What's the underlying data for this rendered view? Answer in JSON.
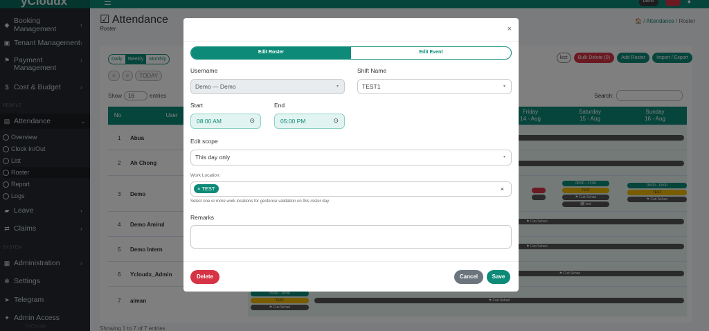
{
  "app": {
    "brand": "yCloudx",
    "user_badge": "Demo"
  },
  "sidebar": {
    "items": [
      {
        "label": "Booking Management"
      },
      {
        "label": "Tenant Management"
      },
      {
        "label": "Payment Management"
      },
      {
        "label": "Cost & Budget"
      }
    ],
    "section_people": "PEOPLE",
    "attendance": "Attendance",
    "sub": [
      "Overview",
      "Clock In/Out",
      "List",
      "Roster",
      "Report",
      "Logs"
    ],
    "leave": "Leave",
    "claims": "Claims",
    "section_system": "SYSTEM",
    "administration": "Administration",
    "settings": "Settings",
    "telegram": "Telegram",
    "admin_access": "Admin Access",
    "footer": "©yCloudx"
  },
  "page": {
    "title": "Attendance",
    "subtitle": "Roster",
    "breadcrumb": {
      "home": "🏠",
      "link": "Attendance",
      "current": "Roster"
    },
    "views": [
      "Daily",
      "Weekly",
      "Monthly"
    ],
    "today": "TODAY",
    "prev": "<",
    "next": ">",
    "toolbar": {
      "select": "lect",
      "bulk_delete": "Bulk Delete (0)",
      "add_roster": "Add Roster",
      "import_export": "Import / Export"
    },
    "show_label": "Show",
    "show_value": "16",
    "entries_label": "entries",
    "search_label": "Search:",
    "table": {
      "headers": {
        "no": "No",
        "user": "User",
        "friday": "Friday",
        "friday_date": "14 - Aug",
        "saturday": "Saturday",
        "saturday_date": "15 - Aug",
        "sunday": "Sunday",
        "sunday_date": "16 - Aug"
      },
      "rows": [
        {
          "no": "1",
          "name": "Abua"
        },
        {
          "no": "2",
          "name": "Ah Chong"
        },
        {
          "no": "3",
          "name": "Demo"
        },
        {
          "no": "4",
          "name": "Demo Amirul"
        },
        {
          "no": "5",
          "name": "Demo Intern"
        },
        {
          "no": "6",
          "name": "Ycloudx_Admin"
        },
        {
          "no": "7",
          "name": "aiman"
        }
      ],
      "shift_time_sat": "08:00 - 17:00",
      "shift_time_sun": "09:00 - 18:00",
      "shift_name": "TEST",
      "leave_label": "⚑ Cuti Sehari",
      "event_label": "🗓 test",
      "aiman_time": "09:00 - 18:00"
    },
    "showing": "Showing 1 to 7 of 7 entries"
  },
  "modal": {
    "close": "×",
    "tabs": [
      "Edit Roster",
      "Edit Event"
    ],
    "username_label": "Username",
    "username_value": "Demo — Demo",
    "shift_label": "Shift Name",
    "shift_value": "TEST1",
    "start_label": "Start",
    "start_value": "08:00 AM",
    "end_label": "End",
    "end_value": "05:00 PM",
    "scope_label": "Edit scope",
    "scope_value": "This day only",
    "location_label": "Work Location:",
    "location_tag": "× TEST",
    "location_clear": "×",
    "location_help": "Select one or more work locations for geofence validation on this roster day.",
    "remarks_label": "Remarks",
    "delete": "Delete",
    "cancel": "Cancel",
    "save": "Save"
  }
}
